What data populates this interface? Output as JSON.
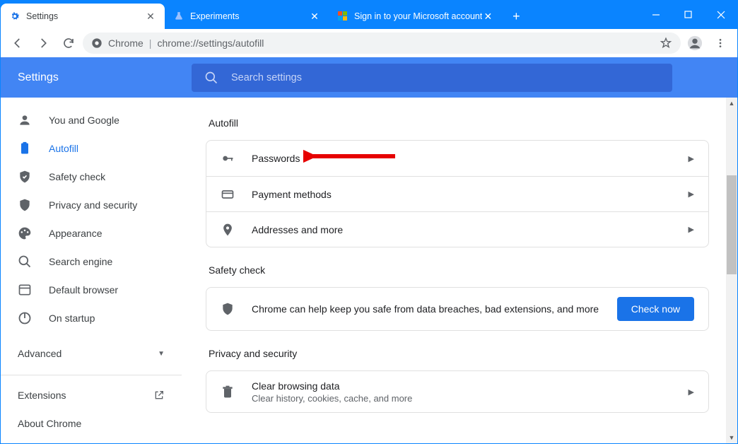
{
  "window": {
    "tabs": [
      {
        "title": "Settings",
        "active": true
      },
      {
        "title": "Experiments",
        "active": false
      },
      {
        "title": "Sign in to your Microsoft account",
        "active": false
      }
    ]
  },
  "omnibox": {
    "scheme": "Chrome",
    "url": "chrome://settings/autofill"
  },
  "header": {
    "title": "Settings",
    "search_placeholder": "Search settings"
  },
  "sidebar": {
    "items": [
      {
        "label": "You and Google",
        "icon": "person"
      },
      {
        "label": "Autofill",
        "icon": "clipboard",
        "selected": true
      },
      {
        "label": "Safety check",
        "icon": "shield-check"
      },
      {
        "label": "Privacy and security",
        "icon": "shield"
      },
      {
        "label": "Appearance",
        "icon": "palette"
      },
      {
        "label": "Search engine",
        "icon": "search"
      },
      {
        "label": "Default browser",
        "icon": "browser"
      },
      {
        "label": "On startup",
        "icon": "power"
      }
    ],
    "advanced_label": "Advanced",
    "extensions_label": "Extensions",
    "about_label": "About Chrome"
  },
  "sections": {
    "autofill": {
      "title": "Autofill",
      "rows": [
        {
          "label": "Passwords",
          "icon": "key"
        },
        {
          "label": "Payment methods",
          "icon": "card"
        },
        {
          "label": "Addresses and more",
          "icon": "location"
        }
      ]
    },
    "safety": {
      "title": "Safety check",
      "message": "Chrome can help keep you safe from data breaches, bad extensions, and more",
      "button": "Check now"
    },
    "privacy": {
      "title": "Privacy and security",
      "rows": [
        {
          "label": "Clear browsing data",
          "sub": "Clear history, cookies, cache, and more",
          "icon": "trash"
        }
      ]
    }
  }
}
